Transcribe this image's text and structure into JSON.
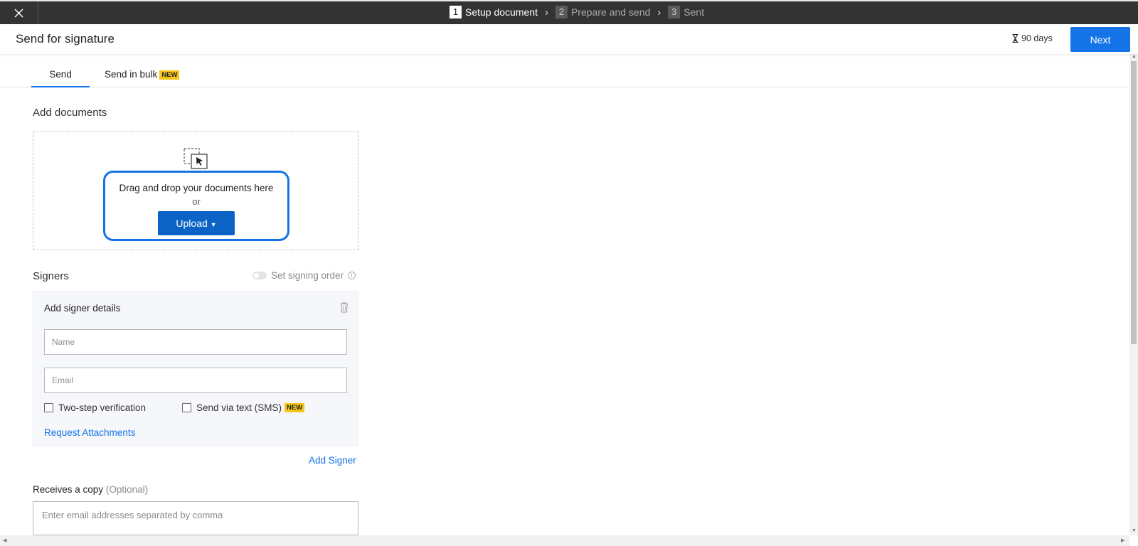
{
  "steps": [
    {
      "num": "1",
      "label": "Setup document"
    },
    {
      "num": "2",
      "label": "Prepare and send"
    },
    {
      "num": "3",
      "label": "Sent"
    }
  ],
  "header": {
    "title": "Send for signature",
    "expiry": "90 days",
    "next_label": "Next"
  },
  "tabs": {
    "send": "Send",
    "bulk": "Send in bulk",
    "bulk_badge": "NEW"
  },
  "documents": {
    "label": "Add documents",
    "drop_text": "Drag and drop your documents here",
    "or_text": "or",
    "upload_label": "Upload"
  },
  "signers": {
    "label": "Signers",
    "signing_order": "Set signing order",
    "card_title": "Add signer details",
    "name_placeholder": "Name",
    "email_placeholder": "Email",
    "two_step": "Two-step verification",
    "sms": "Send via text (SMS)",
    "sms_badge": "NEW",
    "request_attachments": "Request Attachments",
    "add_signer": "Add Signer"
  },
  "copy": {
    "label": "Receives a copy",
    "optional": "(Optional)",
    "placeholder": "Enter email addresses separated by comma"
  },
  "colors": {
    "accent": "#1473e6",
    "topbar": "#333333",
    "badge": "#f5c518"
  }
}
